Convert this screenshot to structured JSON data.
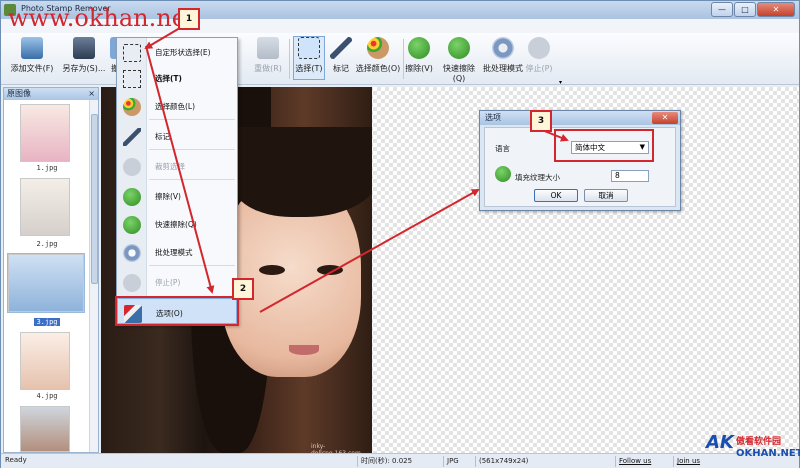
{
  "window": {
    "title": "Photo Stamp Remover",
    "buttons": {
      "minimize": "—",
      "maximize": "□",
      "close": "✕"
    }
  },
  "watermark": "www.okhan.net",
  "toolbar": {
    "items": [
      {
        "label": "添加文件(F)",
        "icon": "add-file-icon"
      },
      {
        "label": "另存为(S)...",
        "icon": "save-as-icon"
      },
      {
        "label": "撤",
        "icon": "undo-icon"
      },
      {
        "label": "重做(R)",
        "icon": "redo-icon"
      },
      {
        "label": "选择(T)",
        "icon": "select-rect-icon"
      },
      {
        "label": "标记",
        "icon": "marker-pen-icon"
      },
      {
        "label": "选择颜色(O)",
        "icon": "palette-icon"
      },
      {
        "label": "擦除(V)",
        "icon": "erase-run-icon"
      },
      {
        "label": "快速擦除(Q)",
        "icon": "quick-erase-icon"
      },
      {
        "label": "批处理模式",
        "icon": "gear-icon"
      },
      {
        "label": "停止(P)",
        "icon": "stop-icon"
      }
    ]
  },
  "left_panel": {
    "title": "原图像",
    "close": "×",
    "thumbnails": [
      {
        "label": "1.jpg"
      },
      {
        "label": "2.jpg"
      },
      {
        "label": "3.jpg",
        "selected": true
      },
      {
        "label": "4.jpg"
      }
    ]
  },
  "context_menu": {
    "items": [
      {
        "label": "自定形状选择(E)",
        "icon": "freeform-select-icon",
        "disabled": false,
        "bold": false
      },
      {
        "label": "选择(T)",
        "icon": "rect-select-icon",
        "disabled": false,
        "bold": true
      },
      {
        "label": "选择颜色(L)",
        "icon": "palette-icon",
        "disabled": false,
        "bold": false
      },
      {
        "label": "标记",
        "icon": "marker-pen-icon",
        "disabled": false,
        "bold": false
      },
      {
        "label": "裁剪选择",
        "icon": "scissors-icon",
        "disabled": true,
        "bold": false
      },
      {
        "label": "擦除(V)",
        "icon": "erase-run-icon",
        "disabled": false,
        "bold": false
      },
      {
        "label": "快速擦除(Q)",
        "icon": "quick-erase-icon",
        "disabled": false,
        "bold": false
      },
      {
        "label": "批处理模式",
        "icon": "gear-icon",
        "disabled": false,
        "bold": false
      },
      {
        "label": "停止(P)",
        "icon": "stop-icon",
        "disabled": true,
        "bold": false
      },
      {
        "label": "选项(O)",
        "icon": "options-tools-icon",
        "disabled": false,
        "bold": false,
        "highlighted": true
      }
    ]
  },
  "photo": {
    "caption": "inky-dollcng.163.com"
  },
  "options_dialog": {
    "title": "选项",
    "close": "✕",
    "language_label": "语言",
    "language_value": "简体中文",
    "texture_label": "填充纹理大小",
    "texture_value": "8",
    "ok_label": "OK",
    "cancel_label": "取消"
  },
  "callouts": {
    "one": "1",
    "two": "2",
    "three": "3"
  },
  "statusbar": {
    "ready": "Ready",
    "time": "时间(秒): 0.025",
    "format": "JPG",
    "dims": "(561x749x24)",
    "follow": "Follow us",
    "join": "Join us"
  },
  "brand": {
    "mark": "AK",
    "cn": "傲看软件园",
    "en": "OKHAN.NET"
  },
  "colors": {
    "annotation_red": "#d3262d",
    "selection_blue": "#3b6fc7",
    "brand_blue": "#1a4fb0"
  }
}
